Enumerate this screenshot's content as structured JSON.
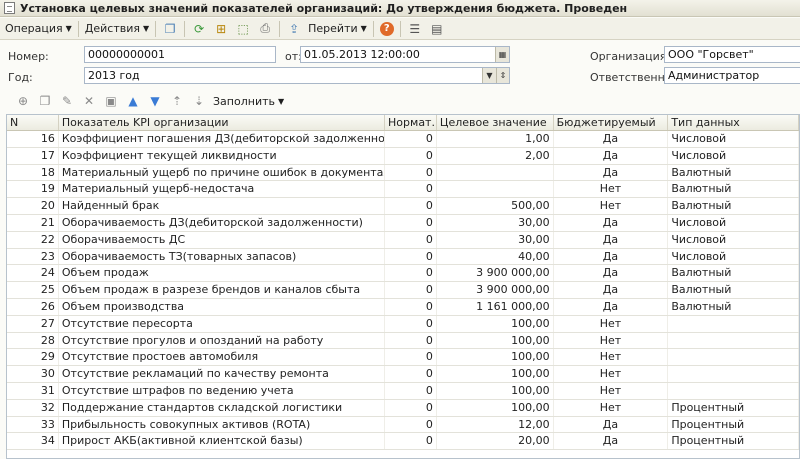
{
  "window": {
    "title": "Установка целевых значений показателей организаций: До утверждения бюджета. Проведен"
  },
  "commandbar": {
    "operation": "Операция",
    "actions": "Действия",
    "goto": "Перейти",
    "help": "?"
  },
  "header": {
    "number_label": "Номер:",
    "number_value": "00000000001",
    "from_label": "от:",
    "date_value": "01.05.2013 12:00:00",
    "org_label": "Организация:",
    "org_value": "ООО \"Горсвет\"",
    "year_label": "Год:",
    "year_value": "2013 год",
    "resp_label": "Ответственный:",
    "resp_value": "Администратор"
  },
  "table_toolbar": {
    "fill": "Заполнить"
  },
  "table": {
    "columns": [
      "N",
      "Показатель KPI организации",
      "Нормат...",
      "Целевое значение",
      "Бюджетируемый",
      "Тип данных"
    ],
    "rows": [
      {
        "n": "16",
        "kpi": "Коэффициент погашения ДЗ(дебиторской задолженности)",
        "norm": "0",
        "target": "1,00",
        "budget": "Да",
        "type": "Числовой"
      },
      {
        "n": "17",
        "kpi": "Коэффициент текущей ликвидности",
        "norm": "0",
        "target": "2,00",
        "budget": "Да",
        "type": "Числовой"
      },
      {
        "n": "18",
        "kpi": "Материальный ущерб по причине ошибок в документах",
        "norm": "0",
        "target": "",
        "budget": "Да",
        "type": "Валютный"
      },
      {
        "n": "19",
        "kpi": "Материальный ущерб-недостача",
        "norm": "0",
        "target": "",
        "budget": "Нет",
        "type": "Валютный"
      },
      {
        "n": "20",
        "kpi": "Найденный брак",
        "norm": "0",
        "target": "500,00",
        "budget": "Нет",
        "type": "Валютный"
      },
      {
        "n": "21",
        "kpi": "Оборачиваемость ДЗ(дебиторской задолженности)",
        "norm": "0",
        "target": "30,00",
        "budget": "Да",
        "type": "Числовой"
      },
      {
        "n": "22",
        "kpi": "Оборачиваемость ДС",
        "norm": "0",
        "target": "30,00",
        "budget": "Да",
        "type": "Числовой"
      },
      {
        "n": "23",
        "kpi": "Оборачиваемость ТЗ(товарных запасов)",
        "norm": "0",
        "target": "40,00",
        "budget": "Да",
        "type": "Числовой"
      },
      {
        "n": "24",
        "kpi": "Объем продаж",
        "norm": "0",
        "target": "3 900 000,00",
        "budget": "Да",
        "type": "Валютный"
      },
      {
        "n": "25",
        "kpi": "Объем продаж в разрезе брендов и каналов сбыта",
        "norm": "0",
        "target": "3 900 000,00",
        "budget": "Да",
        "type": "Валютный"
      },
      {
        "n": "26",
        "kpi": "Объем производства",
        "norm": "0",
        "target": "1 161 000,00",
        "budget": "Да",
        "type": "Валютный"
      },
      {
        "n": "27",
        "kpi": "Отсутствие пересорта",
        "norm": "0",
        "target": "100,00",
        "budget": "Нет",
        "type": ""
      },
      {
        "n": "28",
        "kpi": "Отсутствие прогулов и опозданий на работу",
        "norm": "0",
        "target": "100,00",
        "budget": "Нет",
        "type": ""
      },
      {
        "n": "29",
        "kpi": "Отсутствие простоев автомобиля",
        "norm": "0",
        "target": "100,00",
        "budget": "Нет",
        "type": ""
      },
      {
        "n": "30",
        "kpi": "Отсутствие рекламаций по качеству ремонта",
        "norm": "0",
        "target": "100,00",
        "budget": "Нет",
        "type": ""
      },
      {
        "n": "31",
        "kpi": "Отсутствие штрафов по ведению учета",
        "norm": "0",
        "target": "100,00",
        "budget": "Нет",
        "type": ""
      },
      {
        "n": "32",
        "kpi": "Поддержание стандартов складской логистики",
        "norm": "0",
        "target": "100,00",
        "budget": "Нет",
        "type": "Процентный"
      },
      {
        "n": "33",
        "kpi": "Прибыльность совокупных активов (ROTA)",
        "norm": "0",
        "target": "12,00",
        "budget": "Да",
        "type": "Процентный"
      },
      {
        "n": "34",
        "kpi": "Прирост АКБ(активной клиентской базы)",
        "norm": "0",
        "target": "20,00",
        "budget": "Да",
        "type": "Процентный"
      }
    ]
  }
}
